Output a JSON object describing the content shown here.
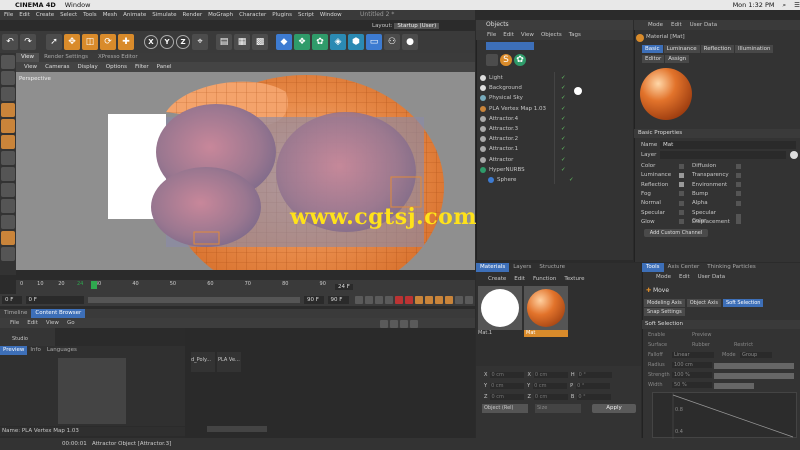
{
  "mac_menu": {
    "app": "CINEMA 4D",
    "window": "Window",
    "time": "Mon 1:32 PM"
  },
  "window_title": "Untitled 2 *",
  "main_menu": [
    "File",
    "Edit",
    "Create",
    "Select",
    "Tools",
    "Mesh",
    "Animate",
    "Simulate",
    "Render",
    "MoGraph",
    "Character",
    "Plugins",
    "Script",
    "Window"
  ],
  "layout": {
    "label": "Layout:",
    "value": "Startup (User)"
  },
  "viewport": {
    "tabs": [
      "View",
      "Render Settings",
      "XPresso Editor"
    ],
    "menu": [
      "View",
      "Cameras",
      "Display",
      "Options",
      "Filter",
      "Panel"
    ],
    "label": "Perspective"
  },
  "timeline": {
    "ticks": [
      "0",
      "10",
      "20",
      "24",
      "30",
      "40",
      "50",
      "60",
      "70",
      "80",
      "90"
    ],
    "current_frame": "24 F",
    "start": "0 F",
    "start2": "0 F",
    "end": "90 F",
    "end2": "90 F"
  },
  "content_browser": {
    "tabs": [
      "Timeline",
      "Content Browser"
    ],
    "menu": [
      "File",
      "Edit",
      "View",
      "Go"
    ],
    "left_item": "Studio",
    "preview_tabs": [
      "Preview",
      "Info",
      "Languages"
    ],
    "items": [
      "d_Poly...",
      "PLA Ve..."
    ],
    "name_label": "Name:",
    "name_value": "PLA Vertex Map 1.03"
  },
  "status": {
    "time": "00:00:01",
    "message": "Attractor Object [Attractor.3]"
  },
  "objects": {
    "title": "Objects",
    "menu": [
      "File",
      "Edit",
      "View",
      "Objects",
      "Tags"
    ],
    "rows": [
      "Light",
      "Background",
      "Physical Sky",
      "PLA Vertex Map 1.03",
      "Attractor.4",
      "Attractor.3",
      "Attractor.2",
      "Attractor.1",
      "Attractor",
      "HyperNURBS",
      "Sphere"
    ]
  },
  "materials": {
    "tabs": [
      "Materials",
      "Layers",
      "Structure"
    ],
    "menu": [
      "Create",
      "Edit",
      "Function",
      "Texture"
    ],
    "items": [
      "Mat.1",
      "Mat"
    ]
  },
  "coordinates": {
    "rows": [
      {
        "a": "X",
        "av": "0 cm",
        "b": "X",
        "bv": "0 cm",
        "c": "H",
        "cv": "0 °"
      },
      {
        "a": "Y",
        "av": "0 cm",
        "b": "Y",
        "bv": "0 cm",
        "c": "P",
        "cv": "0 °"
      },
      {
        "a": "Z",
        "av": "0 cm",
        "b": "Z",
        "bv": "0 cm",
        "c": "B",
        "cv": "0 °"
      }
    ],
    "object_select": "Object (Rel)",
    "size_select": "Size",
    "apply": "Apply"
  },
  "attributes": {
    "menu": [
      "Mode",
      "Edit",
      "User Data"
    ],
    "title": "Material [Mat]",
    "tabs1": [
      "Basic",
      "Luminance",
      "Reflection",
      "Illumination"
    ],
    "tabs2": [
      "Editor",
      "Assign"
    ],
    "section": "Basic Properties",
    "name_label": "Name",
    "name_value": "Mat",
    "layer_label": "Layer",
    "left_props": [
      "Color",
      "Luminance",
      "Reflection",
      "Fog",
      "Normal",
      "Specular",
      "Glow"
    ],
    "right_props": [
      "Diffusion",
      "Transparency",
      "Environment",
      "Bump",
      "Alpha",
      "Specular Color",
      "Displacement"
    ],
    "add_channel": "Add Custom Channel"
  },
  "tools": {
    "tabs": [
      "Tools",
      "Axis Center",
      "Thinking Particles"
    ],
    "menu": [
      "Mode",
      "Edit",
      "User Data"
    ],
    "tool_name": "Move",
    "modes": [
      "Modeling Axis",
      "Object Axis",
      "Soft Selection"
    ],
    "modes2": [
      "Snap Settings"
    ],
    "section": "Soft Selection",
    "rows": [
      {
        "l": "Enable",
        "r": "Preview"
      },
      {
        "l": "Surface",
        "r": "Rubber",
        "r2": "Restrict"
      },
      {
        "l": "Falloff",
        "lv": "Linear",
        "r": "Mode",
        "rv": "Group"
      },
      {
        "l": "Radius",
        "lv": "100 cm"
      },
      {
        "l": "Strength",
        "lv": "100 %"
      },
      {
        "l": "Width",
        "lv": "50 %"
      }
    ],
    "graph_labels": [
      "0.8",
      "0.4"
    ]
  },
  "watermark": "www.cgtsj.com",
  "colors": {
    "accent": "#3d6fb8",
    "orange": "#d98b2b",
    "bg": "#2b2b2b",
    "watermark": "#ffe21a"
  }
}
